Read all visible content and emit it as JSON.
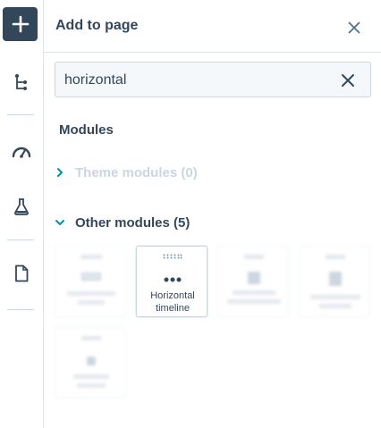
{
  "rail": {
    "items": [
      {
        "name": "add",
        "icon": "plus-icon"
      },
      {
        "name": "structure",
        "icon": "tree-icon"
      },
      {
        "name": "optimize",
        "icon": "gauge-icon"
      },
      {
        "name": "test",
        "icon": "flask-icon"
      },
      {
        "name": "page",
        "icon": "document-icon"
      }
    ]
  },
  "panel": {
    "title": "Add to page",
    "close_icon": "close-icon"
  },
  "search": {
    "value": "horizontal",
    "placeholder": "",
    "clear_icon": "close-icon"
  },
  "modules": {
    "section_label": "Modules",
    "groups": [
      {
        "label": "Theme modules (0)",
        "expanded": false,
        "disabled": true
      },
      {
        "label": "Other modules (5)",
        "expanded": true,
        "disabled": false
      }
    ],
    "tiles": [
      {
        "label": "",
        "blurred": true
      },
      {
        "label": "Horizontal timeline",
        "blurred": false
      },
      {
        "label": "",
        "blurred": true
      },
      {
        "label": "",
        "blurred": true
      },
      {
        "label": "",
        "blurred": true
      }
    ]
  },
  "colors": {
    "primary_dark": "#33475b",
    "accent_teal": "#0091ae",
    "disabled": "#cbd6e2",
    "border": "#dfe3eb"
  }
}
